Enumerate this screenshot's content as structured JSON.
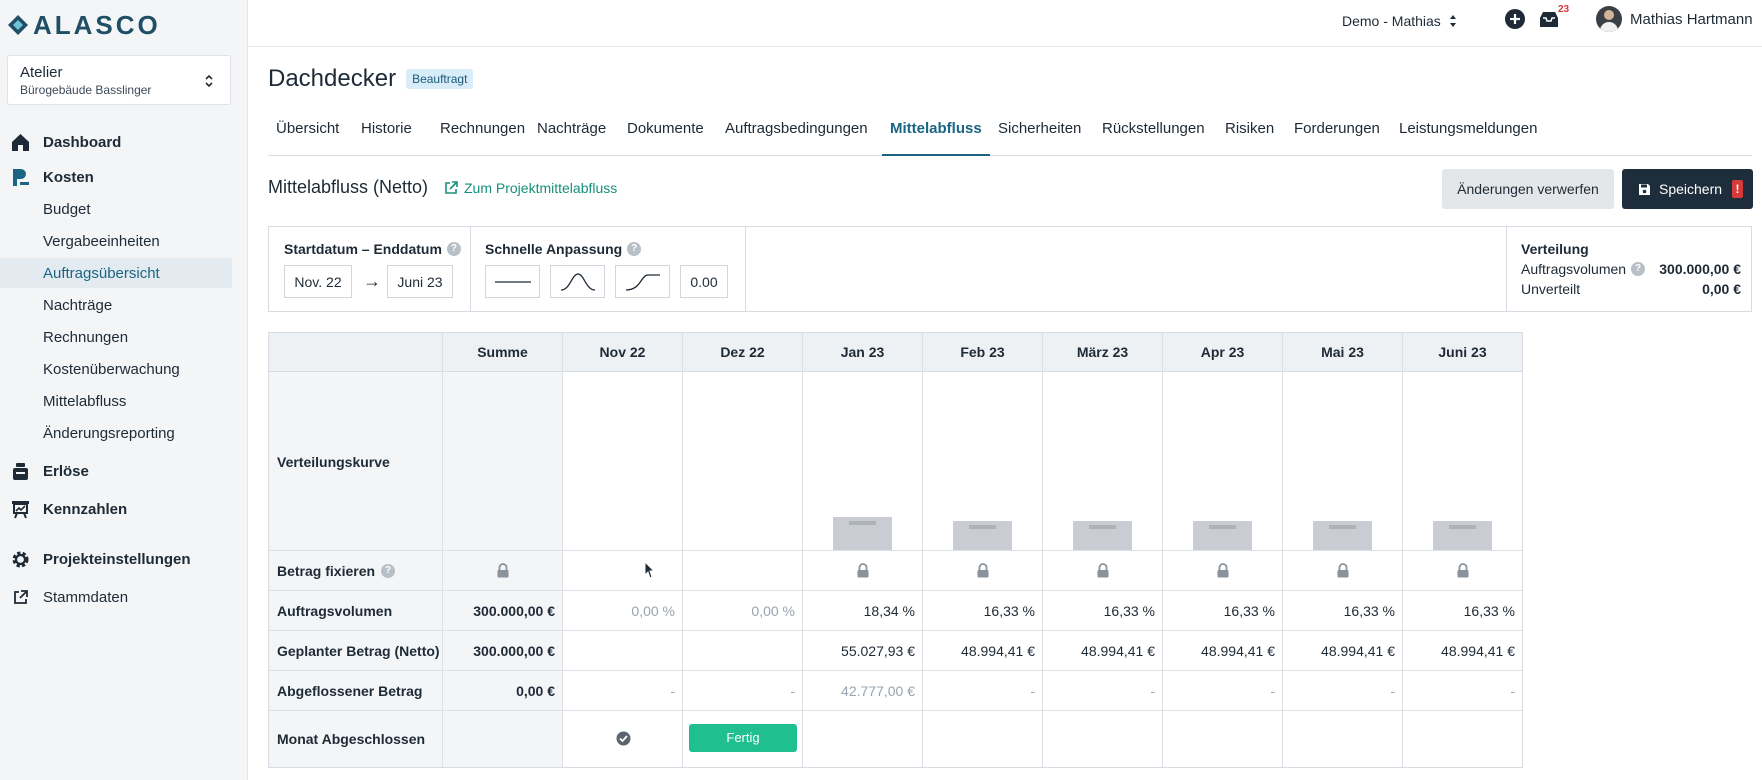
{
  "brand": {
    "name": "ALASCO",
    "logo_icon": "alasco-logo-icon",
    "color": "#1f4e66"
  },
  "project_selector": {
    "name": "Atelier",
    "subtitle": "Bürogebäude Basslinger"
  },
  "sidebar": {
    "main": [
      {
        "label": "Dashboard",
        "icon": "home-icon"
      },
      {
        "label": "Kosten",
        "icon": "costs-icon"
      },
      {
        "label": "Erlöse",
        "icon": "revenue-icon"
      },
      {
        "label": "Kennzahlen",
        "icon": "metrics-icon"
      },
      {
        "label": "Projekteinstellungen",
        "icon": "gear-icon"
      },
      {
        "label": "Stammdaten",
        "icon": "external-link-icon"
      }
    ],
    "kosten_sub": [
      "Budget",
      "Vergabeeinheiten",
      "Auftragsübersicht",
      "Nachträge",
      "Rechnungen",
      "Kostenüberwachung",
      "Mittelabfluss",
      "Änderungsreporting"
    ],
    "active_item": "Auftragsübersicht"
  },
  "topbar": {
    "workspace": "Demo - Mathias",
    "notification_count": "23",
    "user_name": "Mathias Hartmann"
  },
  "header": {
    "title": "Dachdecker",
    "status_badge": "Beauftragt"
  },
  "tabs": [
    "Übersicht",
    "Historie",
    "Rechnungen",
    "Nachträge",
    "Dokumente",
    "Auftragsbedingungen",
    "Mittelabfluss",
    "Sicherheiten",
    "Rückstellungen",
    "Risiken",
    "Forderungen",
    "Leistungsmeldungen"
  ],
  "active_tab": "Mittelabfluss",
  "section": {
    "title": "Mittelabfluss (Netto)",
    "link": "Zum Projektmittelabfluss"
  },
  "actions": {
    "discard": "Änderungen verwerfen",
    "save": "Speichern",
    "save_alert": "!"
  },
  "controls": {
    "date_range_label": "Startdatum – Enddatum",
    "start": "Nov. 22",
    "arrow": "→",
    "end": "Juni 23",
    "quick_label": "Schnelle Anpassung",
    "quick_value": "0.00"
  },
  "distribution": {
    "title": "Verteilung",
    "rows": [
      {
        "label": "Auftragsvolumen",
        "value": "300.000,00 €"
      },
      {
        "label": "Unverteilt",
        "value": "0,00 €"
      }
    ]
  },
  "table": {
    "headers": [
      "Summe",
      "Nov 22",
      "Dez 22",
      "Jan 23",
      "Feb 23",
      "März 23",
      "Apr 23",
      "Mai 23",
      "Juni 23"
    ],
    "row_labels": [
      "Verteilungskurve",
      "Betrag fixieren",
      "Auftragsvolumen",
      "Geplanter Betrag (Netto)",
      "Abgeflossener Betrag",
      "Monat Abgeschlossen"
    ],
    "curve_levels": [
      null,
      0,
      0,
      18.34,
      16.33,
      16.33,
      16.33,
      16.33,
      16.33
    ],
    "auftragsvolumen": [
      "300.000,00 €",
      "0,00 %",
      "0,00 %",
      "18,34 %",
      "16,33 %",
      "16,33 %",
      "16,33 %",
      "16,33 %",
      "16,33 %"
    ],
    "geplant": [
      "300.000,00 €",
      "",
      "",
      "55.027,93 €",
      "48.994,41 €",
      "48.994,41 €",
      "48.994,41 €",
      "48.994,41 €",
      "48.994,41 €"
    ],
    "abgeflossen": [
      "0,00 €",
      "-",
      "-",
      "42.777,00 €",
      "-",
      "-",
      "-",
      "-",
      "-"
    ],
    "fertig_button": "Fertig"
  }
}
